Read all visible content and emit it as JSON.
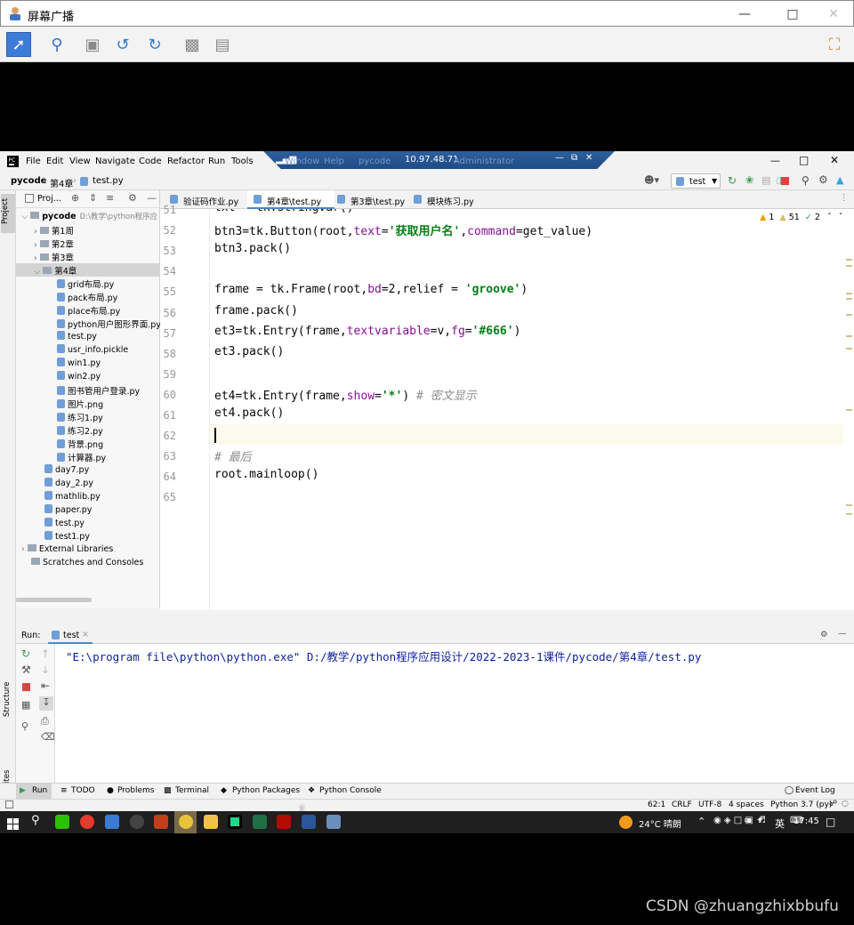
{
  "outer": {
    "title": "屏幕广播",
    "toolbar_icons": [
      "pointer-icon",
      "zoom-icon",
      "monitor-icon",
      "undo-icon",
      "redo-icon",
      "camera-icon",
      "screen-icon",
      "fullscreen-icon"
    ]
  },
  "ide": {
    "menu": [
      "File",
      "Edit",
      "View",
      "Navigate",
      "Code",
      "Refactor",
      "Run",
      "Tools",
      "Window",
      "Help"
    ],
    "remote": {
      "ip": "10.97.48.71",
      "path": "pycode",
      "user": "Administrator"
    },
    "breadcrumb": [
      "pycode",
      "第4章",
      "test.py"
    ],
    "run_config": "test",
    "project_header": "Proj...",
    "tabs": [
      "验证码作业.py",
      "第4章\\test.py",
      "第3章\\test.py",
      "模块练习.py"
    ],
    "inspections": {
      "warnings": "1",
      "weak_warnings": "51",
      "typos": "2"
    },
    "tree": [
      {
        "label": "pycode",
        "extra": "D:\\教学\\python程序应",
        "kind": "folder",
        "indent": 0
      },
      {
        "label": "第1周",
        "kind": "folder",
        "indent": 1
      },
      {
        "label": "第2章",
        "kind": "folder",
        "indent": 1
      },
      {
        "label": "第3章",
        "kind": "folder",
        "indent": 1
      },
      {
        "label": "第4章",
        "kind": "folder",
        "indent": 1,
        "selected": true
      },
      {
        "label": "grid布局.py",
        "kind": "file",
        "indent": 2
      },
      {
        "label": "pack布局.py",
        "kind": "file",
        "indent": 2
      },
      {
        "label": "place布局.py",
        "kind": "file",
        "indent": 2
      },
      {
        "label": "python用户图形界面.py",
        "kind": "file",
        "indent": 2
      },
      {
        "label": "test.py",
        "kind": "file",
        "indent": 2
      },
      {
        "label": "usr_info.pickle",
        "kind": "file",
        "indent": 2
      },
      {
        "label": "win1.py",
        "kind": "file",
        "indent": 2
      },
      {
        "label": "win2.py",
        "kind": "file",
        "indent": 2
      },
      {
        "label": "图书管用户登录.py",
        "kind": "file",
        "indent": 2
      },
      {
        "label": "图片.png",
        "kind": "file",
        "indent": 2
      },
      {
        "label": "练习1.py",
        "kind": "file",
        "indent": 2
      },
      {
        "label": "练习2.py",
        "kind": "file",
        "indent": 2
      },
      {
        "label": "背景.png",
        "kind": "file",
        "indent": 2
      },
      {
        "label": "计算器.py",
        "kind": "file",
        "indent": 2
      },
      {
        "label": "day7.py",
        "kind": "file",
        "indent": 1
      },
      {
        "label": "day_2.py",
        "kind": "file",
        "indent": 1
      },
      {
        "label": "mathlib.py",
        "kind": "file",
        "indent": 1
      },
      {
        "label": "paper.py",
        "kind": "file",
        "indent": 1
      },
      {
        "label": "test.py",
        "kind": "file",
        "indent": 1
      },
      {
        "label": "test1.py",
        "kind": "file",
        "indent": 1
      },
      {
        "label": "External Libraries",
        "kind": "lib",
        "indent": 0
      },
      {
        "label": "Scratches and Consoles",
        "kind": "lib",
        "indent": 0
      }
    ],
    "line_numbers": [
      "51",
      "52",
      "53",
      "54",
      "55",
      "56",
      "57",
      "58",
      "59",
      "60",
      "61",
      "62",
      "63",
      "64",
      "65"
    ],
    "code_lines": [
      "txt = tk.StringVar()",
      "btn3=tk.Button(root,text='获取用户名',command=get_value)",
      "btn3.pack()",
      "",
      "frame = tk.Frame(root,bd=2,relief = 'groove')",
      "frame.pack()",
      "et3=tk.Entry(frame,textvariable=v,fg='#666')",
      "et3.pack()",
      "",
      "et4=tk.Entry(frame,show='*') # 密文显示",
      "et4.pack()",
      "",
      "# 最后",
      "root.mainloop()",
      ""
    ],
    "current_line": "62",
    "run": {
      "label": "Run:",
      "tab": "test",
      "console": "\"E:\\program file\\python\\python.exe\" D:/教学/python程序应用设计/2022-2023-1课件/pycode/第4章/test.py"
    },
    "bottom_tabs": [
      "Run",
      "TODO",
      "Problems",
      "Terminal",
      "Python Packages",
      "Python Console"
    ],
    "event_log": "Event Log",
    "status": {
      "pos": "62:1",
      "eol": "CRLF",
      "enc": "UTF-8",
      "indent": "4 spaces",
      "interp": "Python 3.7 (py)"
    },
    "side_labels": {
      "project": "Project",
      "structure": "Structure",
      "favorites": "Favorites"
    }
  },
  "taskbar": {
    "weather": "24°C 晴朗",
    "ime": "英",
    "time": "17:45"
  },
  "watermark": "CSDN @zhuangzhixbbufu",
  "colors": {
    "keyword_arg": "#871094",
    "string": "#067d17",
    "comment": "#8c8c8c",
    "console": "#0b1f9b",
    "accent": "#4a88c7"
  }
}
